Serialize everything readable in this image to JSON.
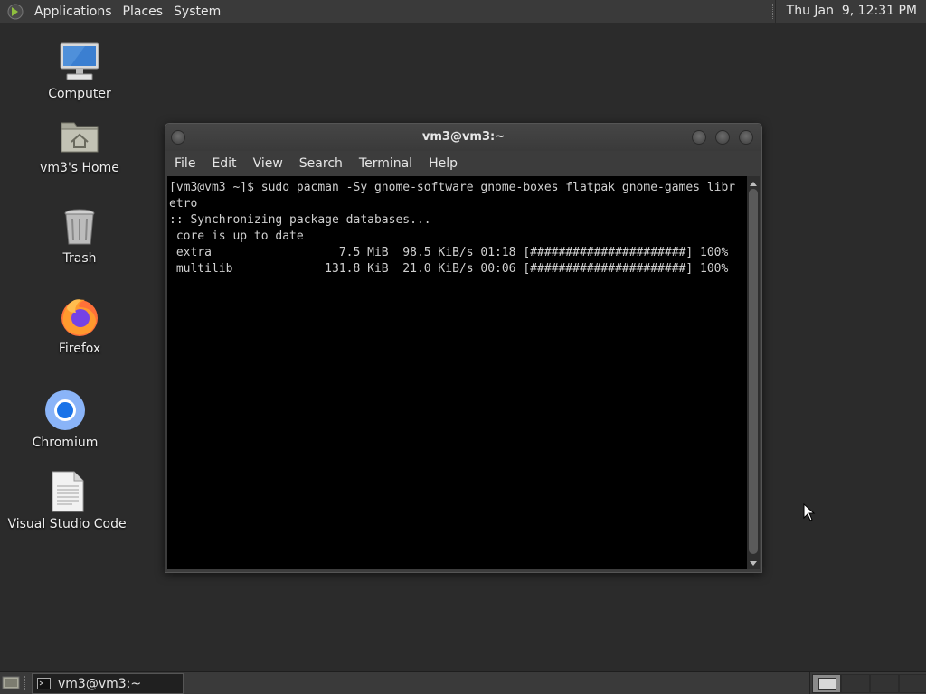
{
  "top_panel": {
    "menus": [
      "Applications",
      "Places",
      "System"
    ],
    "clock": "Thu Jan  9, 12:31 PM"
  },
  "desktop": {
    "icons": [
      {
        "label": "Computer",
        "icon": "computer-icon"
      },
      {
        "label": "vm3's Home",
        "icon": "home-folder-icon"
      },
      {
        "label": "Trash",
        "icon": "trash-icon"
      },
      {
        "label": "Firefox",
        "icon": "firefox-icon"
      },
      {
        "label": "Chromium",
        "icon": "chromium-icon"
      },
      {
        "label": "Visual Studio Code",
        "icon": "document-icon"
      }
    ]
  },
  "terminal": {
    "title": "vm3@vm3:~",
    "menu": [
      "File",
      "Edit",
      "View",
      "Search",
      "Terminal",
      "Help"
    ],
    "output": "[vm3@vm3 ~]$ sudo pacman -Sy gnome-software gnome-boxes flatpak gnome-games libr\netro\n:: Synchronizing package databases...\n core is up to date\n extra                  7.5 MiB  98.5 KiB/s 01:18 [######################] 100%\n multilib             131.8 KiB  21.0 KiB/s 00:06 [######################] 100%"
  },
  "bottom_panel": {
    "task": "vm3@vm3:~"
  },
  "colors": {
    "desktop_bg": "#2b2b2b",
    "panel_bg": "#3a3a3a",
    "terminal_bg": "#000000",
    "terminal_fg": "#d0d0d0"
  }
}
